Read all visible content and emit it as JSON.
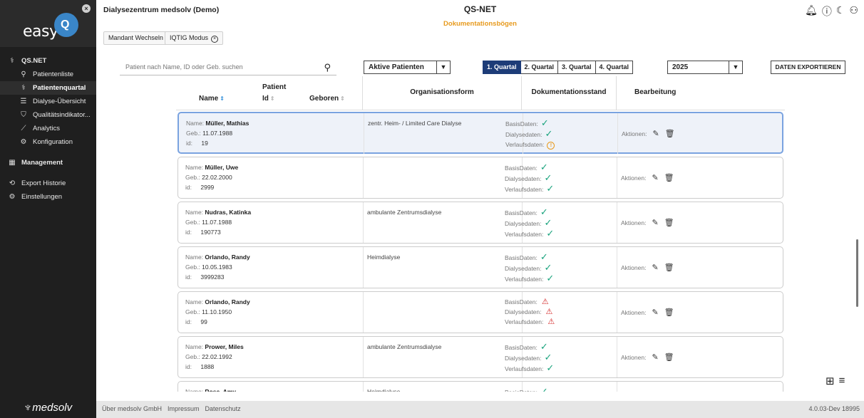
{
  "sidebar": {
    "logo_text": "easy",
    "nav": [
      {
        "label": "QS.NET",
        "icon": "⚕",
        "kind": "section"
      },
      {
        "label": "Patientenliste",
        "icon": "⚲",
        "kind": "sub"
      },
      {
        "label": "Patientenquartal",
        "icon": "⚕",
        "kind": "sub-active"
      },
      {
        "label": "Dialyse-Übersicht",
        "icon": "☰",
        "kind": "sub"
      },
      {
        "label": "Qualitätsindikator...",
        "icon": "⛉",
        "kind": "sub"
      },
      {
        "label": "Analytics",
        "icon": "⟋",
        "kind": "sub"
      },
      {
        "label": "Konfiguration",
        "icon": "⚙",
        "kind": "sub"
      },
      {
        "label": "Management",
        "icon": "▦",
        "kind": "section"
      },
      {
        "label": "Export Historie",
        "icon": "⟲",
        "kind": "item"
      },
      {
        "label": "Einstellungen",
        "icon": "⚙",
        "kind": "item"
      }
    ],
    "footer_logo": "medsolv"
  },
  "header": {
    "clinic_name": "Dialysezentrum medsolv (Demo)",
    "mandant_button": "Mandant Wechseln",
    "iqtig_button": "IQTIG Modus",
    "app_title": "QS-NET",
    "app_subtitle": "Dokumentationsbögen"
  },
  "toolbar": {
    "search_placeholder": "Patient nach Name, ID oder Geb. suchen",
    "patient_filter": "Aktive Patienten",
    "quarters": [
      "1. Quartal",
      "2. Quartal",
      "3. Quartal",
      "4. Quartal"
    ],
    "active_quarter": 0,
    "year": "2025",
    "export_label": "DATEN EXPORTIEREN"
  },
  "table": {
    "headers": {
      "name": "Name",
      "patient_id_1": "Patient",
      "patient_id_2": "Id",
      "geboren": "Geboren",
      "organisationsform": "Organisationsform",
      "dokumentationsstand": "Dokumentationsstand",
      "bearbeitung": "Bearbeitung"
    },
    "labels": {
      "name": "Name:",
      "geb": "Geb.:",
      "id": "id:",
      "basis": "BasisDaten:",
      "dialyse": "Dialysedaten:",
      "verlauf": "Verlaufsdaten:",
      "aktionen": "Aktionen:"
    },
    "rows": [
      {
        "name": "Müller, Mathias",
        "geb": "11.07.1988",
        "id": "19",
        "org": "zentr. Heim- / Limited Care Dialyse",
        "basis": "ok",
        "dialyse": "ok",
        "verlauf": "info",
        "selected": true
      },
      {
        "name": "Müller, Uwe",
        "geb": "22.02.2000",
        "id": "2999",
        "org": "",
        "basis": "ok",
        "dialyse": "ok",
        "verlauf": "ok",
        "selected": false
      },
      {
        "name": "Nudras, Katinka",
        "geb": "11.07.1988",
        "id": "190773",
        "org": "ambulante Zentrumsdialyse",
        "basis": "ok",
        "dialyse": "ok",
        "verlauf": "ok",
        "selected": false
      },
      {
        "name": "Orlando, Randy",
        "geb": "10.05.1983",
        "id": "3999283",
        "org": "Heimdialyse",
        "basis": "ok",
        "dialyse": "ok",
        "verlauf": "ok",
        "selected": false
      },
      {
        "name": "Orlando, Randy",
        "geb": "11.10.1950",
        "id": "99",
        "org": "",
        "basis": "warn",
        "dialyse": "warn",
        "verlauf": "warn",
        "selected": false
      },
      {
        "name": "Prower, Miles",
        "geb": "22.02.1992",
        "id": "1888",
        "org": "ambulante Zentrumsdialyse",
        "basis": "ok",
        "dialyse": "ok",
        "verlauf": "ok",
        "selected": false
      },
      {
        "name": "Rose, Amy",
        "geb": "",
        "id": "",
        "org": "Heimdialyse",
        "basis": "ok",
        "dialyse": "",
        "verlauf": "",
        "selected": false
      }
    ]
  },
  "footer": {
    "links": [
      "Über medsolv GmbH",
      "Impressum",
      "Datenschutz"
    ],
    "version": "4.0.03-Dev 18995"
  },
  "colors": {
    "sidebar_bg": "#1f1f1f",
    "accent_blue": "#1d3c78",
    "subtitle_orange": "#e79a1d",
    "ok_green": "#19a37d",
    "warn_red": "#d42a2a",
    "selected_row_border": "#7aa3e0"
  }
}
